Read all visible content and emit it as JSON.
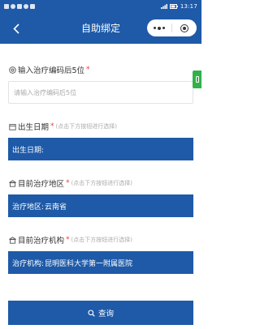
{
  "status_bar": {
    "time": "13:17"
  },
  "nav": {
    "title": "自助绑定"
  },
  "fields": {
    "code": {
      "label": "输入治疗编码后5位",
      "required": "*",
      "placeholder": "请输入治疗编码后5位",
      "value": ""
    },
    "birth": {
      "label": "出生日期",
      "required": "*",
      "hint": "(点击下方按钮进行选择)",
      "prefix": "出生日期:",
      "value": ""
    },
    "region": {
      "label": "目前治疗地区",
      "required": "*",
      "hint": "(点击下方按钮进行选择)",
      "prefix": "治疗地区:",
      "value": "云南省"
    },
    "institution": {
      "label": "目前治疗机构",
      "required": "*",
      "hint": "(点击下方按钮进行选择)",
      "prefix": "治疗机构:",
      "value": "昆明医科大学第一附属医院"
    }
  },
  "query_button": {
    "label": "查询"
  },
  "colors": {
    "primary": "#1e5aa8",
    "required": "#e53935",
    "side_tab": "#32b14a"
  },
  "icons": {
    "back": "chevron-left-icon",
    "more": "more-dots-icon",
    "close": "target-icon",
    "code": "circle-at-icon",
    "birth": "calendar-icon",
    "region": "building-icon",
    "institution": "building-icon",
    "query": "search-icon"
  }
}
